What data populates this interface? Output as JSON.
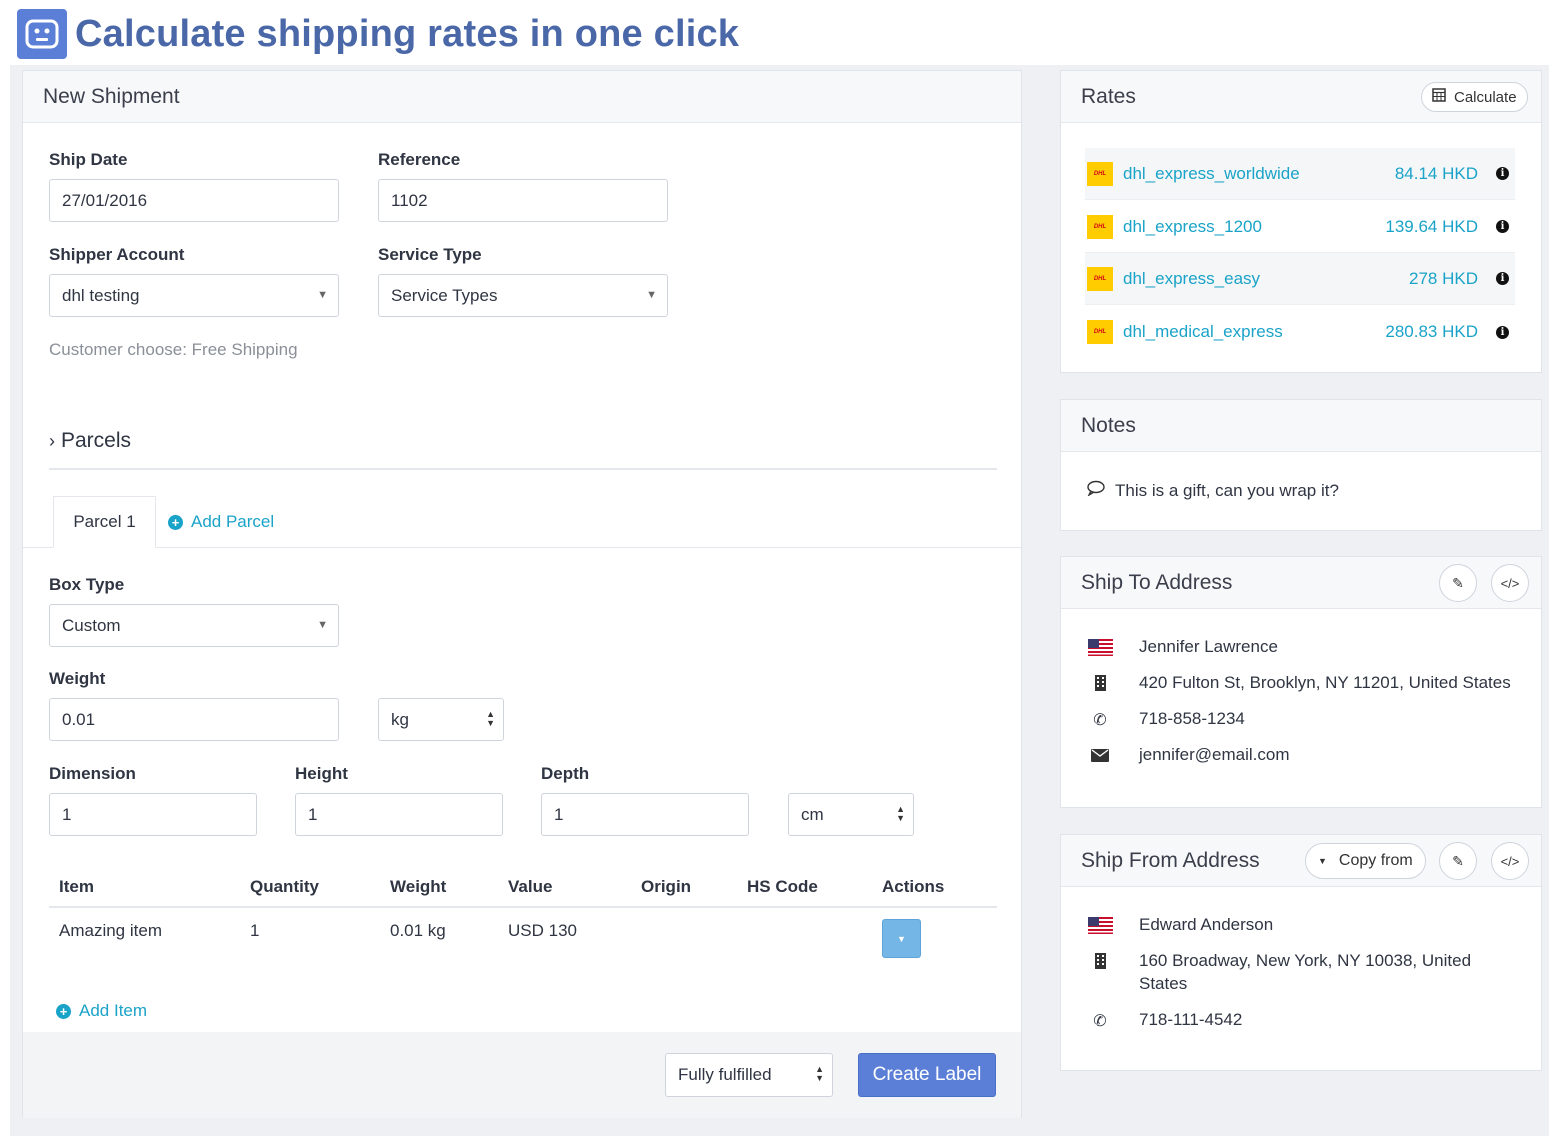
{
  "hero": {
    "title": "Calculate shipping rates in one click"
  },
  "shipment": {
    "title": "New Shipment",
    "ship_date_label": "Ship Date",
    "ship_date": "27/01/2016",
    "reference_label": "Reference",
    "reference": "1102",
    "shipper_account_label": "Shipper Account",
    "shipper_account": "dhl testing",
    "service_type_label": "Service Type",
    "service_type": "Service Types",
    "customer_choose": "Customer choose: Free Shipping",
    "parcels_label": "Parcels",
    "parcel_tab": "Parcel 1",
    "add_parcel": "Add Parcel",
    "box_type_label": "Box Type",
    "box_type": "Custom",
    "weight_label": "Weight",
    "weight": "0.01",
    "weight_unit": "kg",
    "dimension_label": "Dimension",
    "dimension": "1",
    "height_label": "Height",
    "height": "1",
    "depth_label": "Depth",
    "depth": "1",
    "dim_unit": "cm",
    "table": {
      "headers": [
        "Item",
        "Quantity",
        "Weight",
        "Value",
        "Origin",
        "HS Code",
        "Actions"
      ],
      "rows": [
        {
          "item": "Amazing item",
          "quantity": "1",
          "weight": "0.01 kg",
          "value": "USD 130",
          "origin": "",
          "hs_code": ""
        }
      ]
    },
    "add_item": "Add Item",
    "fulfillment": "Fully fulfilled",
    "create_label": "Create Label"
  },
  "rates": {
    "title": "Rates",
    "calculate": "Calculate",
    "items": [
      {
        "name": "dhl_express_worldwide",
        "price": "84.14 HKD"
      },
      {
        "name": "dhl_express_1200",
        "price": "139.64 HKD"
      },
      {
        "name": "dhl_express_easy",
        "price": "278 HKD"
      },
      {
        "name": "dhl_medical_express",
        "price": "280.83 HKD"
      }
    ]
  },
  "notes": {
    "title": "Notes",
    "text": "This is a gift, can you wrap it?"
  },
  "ship_to": {
    "title": "Ship To Address",
    "name": "Jennifer Lawrence",
    "address": "420 Fulton St, Brooklyn, NY 11201, United States",
    "phone": "718-858-1234",
    "email": "jennifer@email.com"
  },
  "ship_from": {
    "title": "Ship From Address",
    "copy_from": "Copy from",
    "name": "Edward Anderson",
    "address_line1": "160 Broadway, New York, NY 10038, United",
    "address_line2": "States",
    "phone": "718-111-4542"
  },
  "colors": {
    "accent": "#1aa3c8",
    "primary_button": "#5b7fd6",
    "hero_title": "#4a67a8"
  }
}
